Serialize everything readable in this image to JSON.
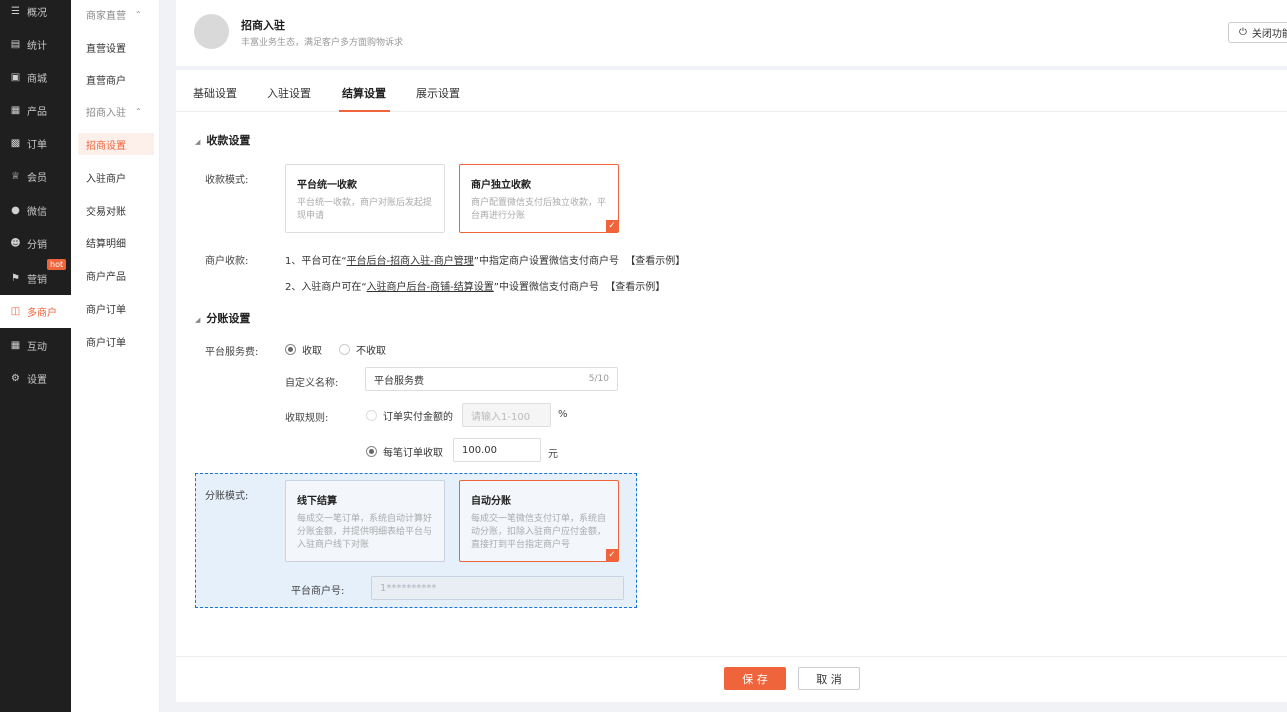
{
  "sidebar": {
    "items": [
      {
        "label": "概况",
        "icon": "layers-icon"
      },
      {
        "label": "统计",
        "icon": "chart-icon"
      },
      {
        "label": "商城",
        "icon": "store-icon"
      },
      {
        "label": "产品",
        "icon": "grid-icon"
      },
      {
        "label": "订单",
        "icon": "clipboard-icon"
      },
      {
        "label": "会员",
        "icon": "crown-icon"
      },
      {
        "label": "微信",
        "icon": "chat-icon"
      },
      {
        "label": "分销",
        "icon": "users-icon"
      },
      {
        "label": "营销",
        "icon": "flag-icon"
      },
      {
        "label": "多商户",
        "icon": "merchant-icon"
      },
      {
        "label": "互动",
        "icon": "apps-icon"
      },
      {
        "label": "设置",
        "icon": "gear-icon"
      }
    ],
    "hot_badge": "hot"
  },
  "submenu": {
    "group1": "商家直营",
    "item1": "直营设置",
    "item2": "直营商户",
    "group2": "招商入驻",
    "item3": "招商设置",
    "item4": "入驻商户",
    "item5": "交易对账",
    "item6": "结算明细",
    "item7": "商户产品",
    "item8": "商户订单",
    "item9": "商户订单"
  },
  "header": {
    "title": "招商入驻",
    "subtitle": "丰富业务生态，满足客户多方面购物诉求",
    "close_label": "关闭功能"
  },
  "tabs": [
    "基础设置",
    "入驻设置",
    "结算设置",
    "展示设置"
  ],
  "collection": {
    "section_title": "收款设置",
    "mode_label": "收款模式:",
    "option1_title": "平台统一收款",
    "option1_desc": "平台统一收款，商户对账后发起提现申请",
    "option2_title": "商户独立收款",
    "option2_desc": "商户配置微信支付后独立收款，平台再进行分账",
    "merchant_label": "商户收款:",
    "line1_prefix": "1、平台可在“",
    "line1_link": "平台后台-招商入驻-商户管理",
    "line1_suffix": "”中指定商户设置微信支付商户号",
    "line1_example": "【查看示例】",
    "line2_prefix": "2、入驻商户可在“",
    "line2_link": "入驻商户后台-商铺-结算设置",
    "line2_suffix": "”中设置微信支付商户号",
    "line2_example": "【查看示例】"
  },
  "split": {
    "section_title": "分账设置",
    "fee_label": "平台服务费:",
    "fee_on": "收取",
    "fee_off": "不收取",
    "name_label": "自定义名称:",
    "name_value": "平台服务费",
    "name_count": "5/10",
    "rule_label": "收取规则:",
    "rule1": "订单实付金额的",
    "rule1_placeholder": "请输入1-100",
    "rule1_unit": "%",
    "rule2": "每笔订单收取",
    "rule2_value": "100.00",
    "rule2_unit": "元",
    "mode_label": "分账模式:",
    "mode1_title": "线下结算",
    "mode1_desc": "每成交一笔订单，系统自动计算好分账金额，并提供明细表给平台与入驻商户线下对账",
    "mode2_title": "自动分账",
    "mode2_desc": "每成交一笔微信支付订单，系统自动分账，扣除入驻商户应付金额，直接打到平台指定商户号",
    "merchant_no_label": "平台商户号:",
    "merchant_no_value": "1**********"
  },
  "footer": {
    "save": "保 存",
    "cancel": "取 消"
  },
  "colors": {
    "accent": "#f0643c",
    "sidebar_bg": "#1f1f1f",
    "highlight_bg": "#e6f0fb",
    "highlight_border": "#1a73d8"
  }
}
